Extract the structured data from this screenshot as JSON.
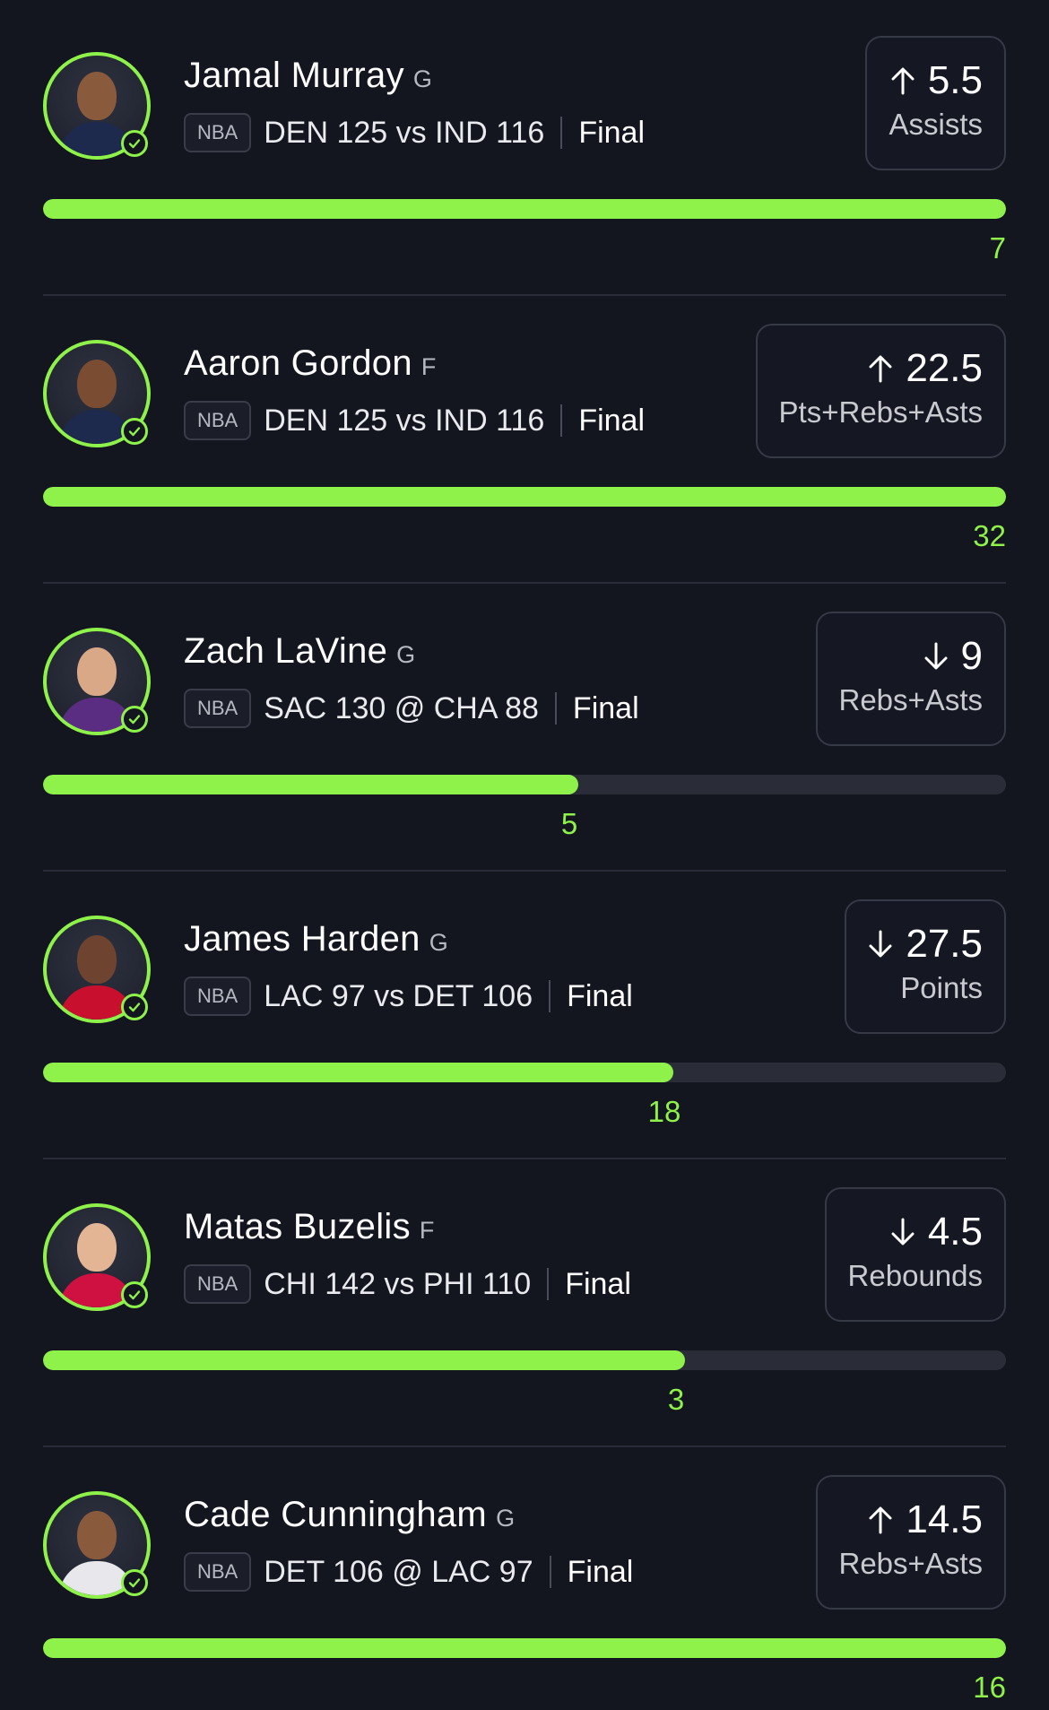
{
  "colors": {
    "background": "#13151f",
    "accent": "#8ef24a",
    "track": "#2a2c37"
  },
  "picks": [
    {
      "name": "Jamal Murray",
      "position": "G",
      "league": "NBA",
      "game": "DEN 125 vs IND 116",
      "status": "Final",
      "direction": "up",
      "direction_icon": "arrow-up-icon",
      "line": "5.5",
      "stat": "Assists",
      "actual": "7",
      "progress": 1.0,
      "skin": "#8a5a3c",
      "jersey": "#1d2a4d"
    },
    {
      "name": "Aaron Gordon",
      "position": "F",
      "league": "NBA",
      "game": "DEN 125 vs IND 116",
      "status": "Final",
      "direction": "up",
      "direction_icon": "arrow-up-icon",
      "line": "22.5",
      "stat": "Pts+Rebs+Asts",
      "actual": "32",
      "progress": 1.0,
      "skin": "#7a4d33",
      "jersey": "#1d2a4d"
    },
    {
      "name": "Zach LaVine",
      "position": "G",
      "league": "NBA",
      "game": "SAC 130 @ CHA 88",
      "status": "Final",
      "direction": "down",
      "direction_icon": "arrow-down-icon",
      "line": "9",
      "stat": "Rebs+Asts",
      "actual": "5",
      "progress": 0.556,
      "skin": "#d9a886",
      "jersey": "#5a2d82"
    },
    {
      "name": "James Harden",
      "position": "G",
      "league": "NBA",
      "game": "LAC 97 vs DET 106",
      "status": "Final",
      "direction": "down",
      "direction_icon": "arrow-down-icon",
      "line": "27.5",
      "stat": "Points",
      "actual": "18",
      "progress": 0.655,
      "skin": "#6e4430",
      "jersey": "#c8102e"
    },
    {
      "name": "Matas Buzelis",
      "position": "F",
      "league": "NBA",
      "game": "CHI 142 vs PHI 110",
      "status": "Final",
      "direction": "down",
      "direction_icon": "arrow-down-icon",
      "line": "4.5",
      "stat": "Rebounds",
      "actual": "3",
      "progress": 0.667,
      "skin": "#e3b595",
      "jersey": "#ce1141"
    },
    {
      "name": "Cade Cunningham",
      "position": "G",
      "league": "NBA",
      "game": "DET 106 @ LAC 97",
      "status": "Final",
      "direction": "up",
      "direction_icon": "arrow-up-icon",
      "line": "14.5",
      "stat": "Rebs+Asts",
      "actual": "16",
      "progress": 1.0,
      "skin": "#8a5a3c",
      "jersey": "#e8e8ec"
    }
  ]
}
